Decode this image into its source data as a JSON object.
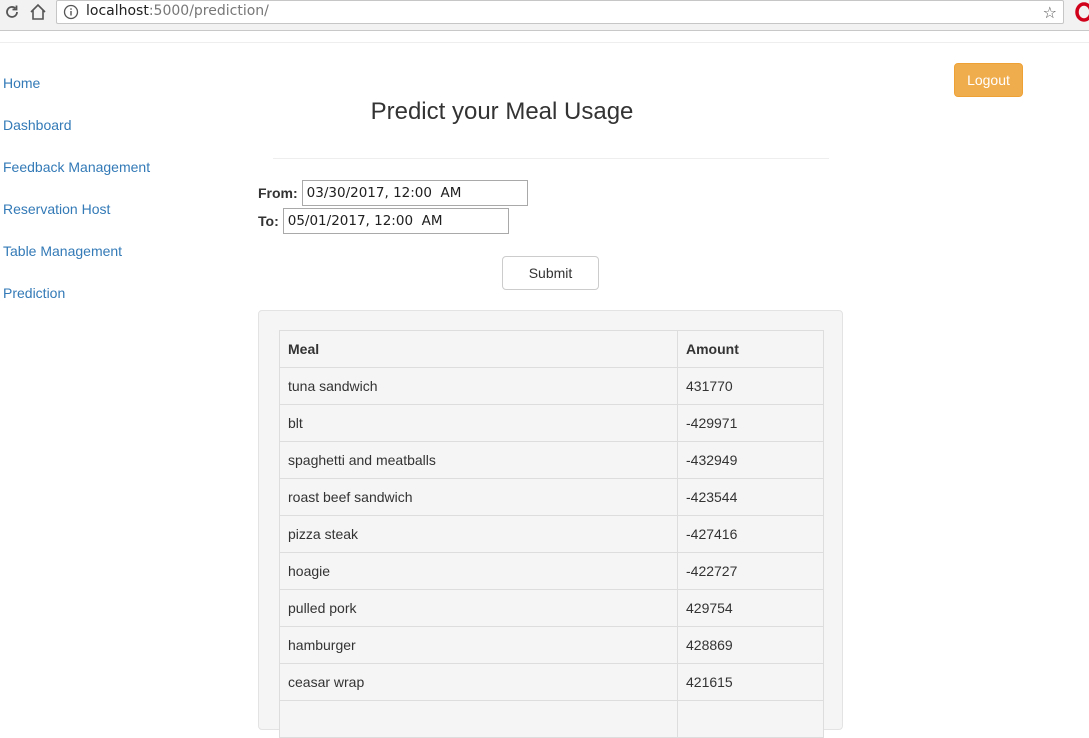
{
  "browser": {
    "url_host": "localhost",
    "url_path": ":5000/prediction/"
  },
  "sidebar": {
    "items": [
      {
        "label": "Home"
      },
      {
        "label": "Dashboard"
      },
      {
        "label": "Feedback Management"
      },
      {
        "label": "Reservation Host"
      },
      {
        "label": "Table Management"
      },
      {
        "label": "Prediction"
      }
    ]
  },
  "header": {
    "logout_label": "Logout"
  },
  "main": {
    "title": "Predict your Meal Usage",
    "from_label": "From:",
    "from_value": "03/30/2017, 12:00  AM",
    "to_label": "To:",
    "to_value": "05/01/2017, 12:00  AM",
    "submit_label": "Submit",
    "table": {
      "headers": [
        "Meal",
        "Amount"
      ],
      "rows": [
        {
          "meal": "tuna sandwich",
          "amount": "431770"
        },
        {
          "meal": "blt",
          "amount": "-429971"
        },
        {
          "meal": "spaghetti and meatballs",
          "amount": "-432949"
        },
        {
          "meal": "roast beef sandwich",
          "amount": "-423544"
        },
        {
          "meal": "pizza steak",
          "amount": "-427416"
        },
        {
          "meal": "hoagie",
          "amount": "-422727"
        },
        {
          "meal": "pulled pork",
          "amount": "429754"
        },
        {
          "meal": "hamburger",
          "amount": "428869"
        },
        {
          "meal": "ceasar wrap",
          "amount": "421615"
        },
        {
          "meal": "",
          "amount": ""
        }
      ]
    }
  },
  "colors": {
    "link": "#337ab7",
    "warning": "#f0ad4e"
  }
}
